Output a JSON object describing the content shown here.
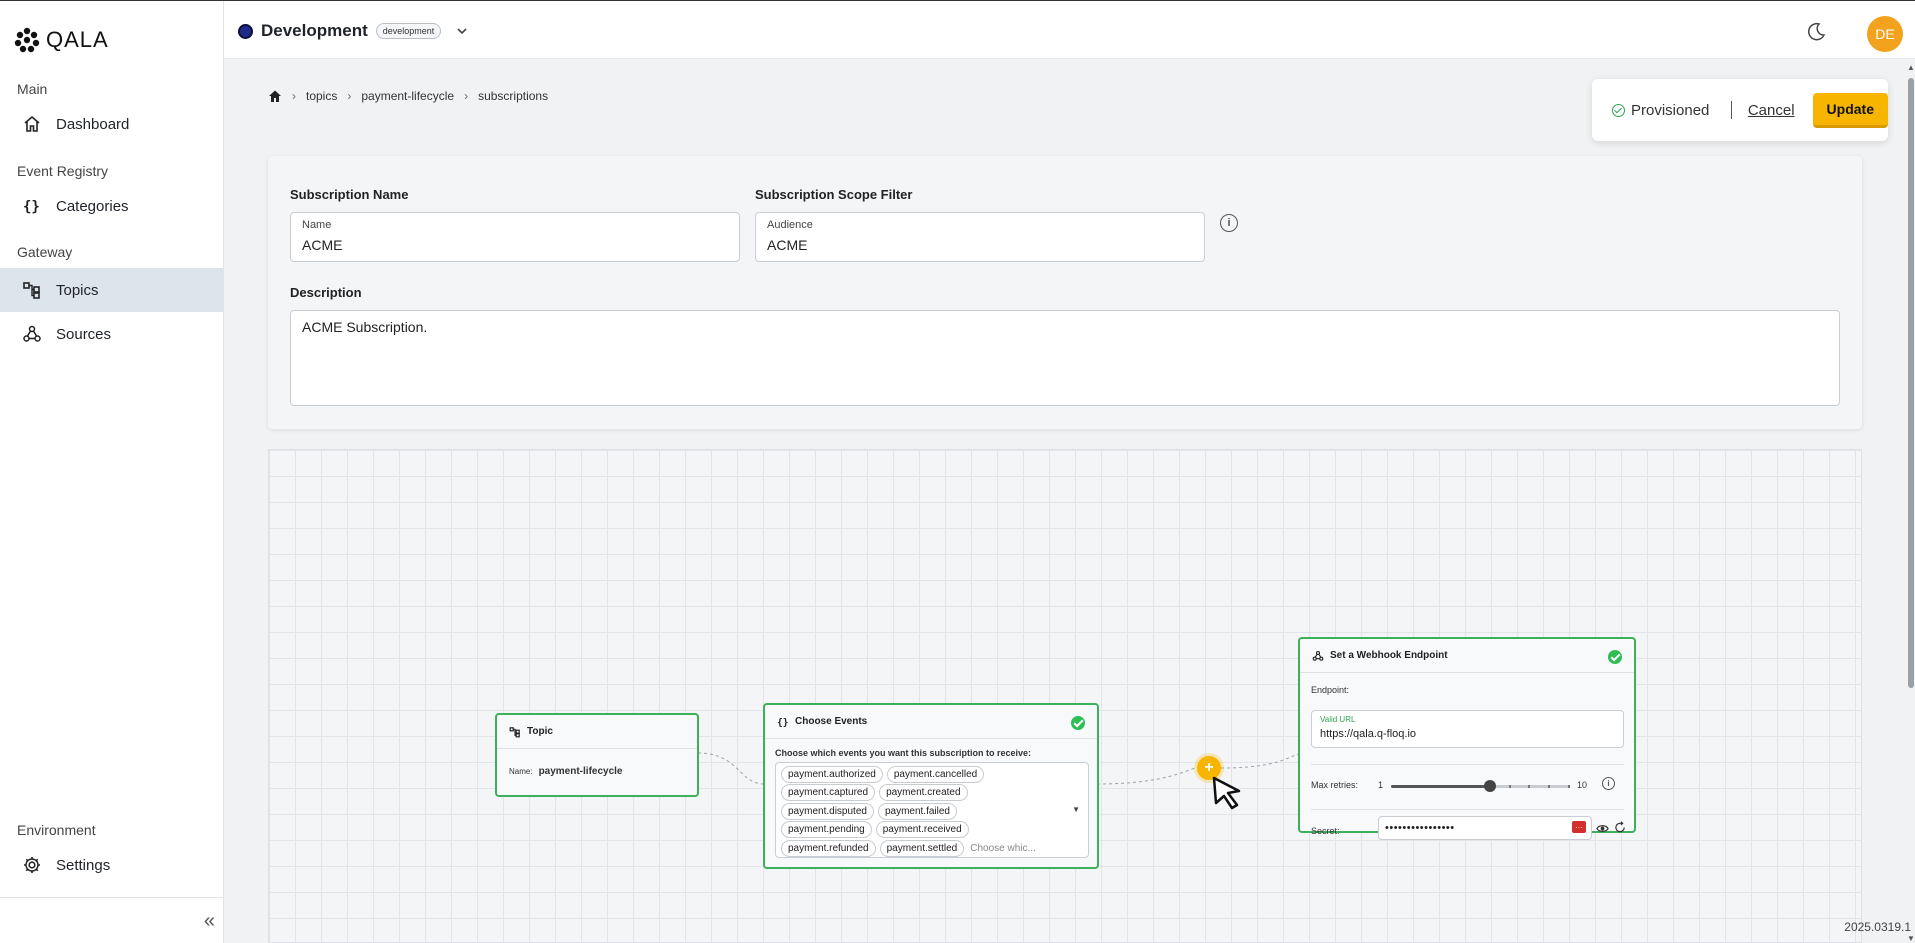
{
  "app": {
    "logo_text": "QALA",
    "version": "2025.0319.1"
  },
  "header": {
    "environment": "Development",
    "environment_badge": "development",
    "avatar_initials": "DE"
  },
  "sidebar": {
    "sections": [
      {
        "title": "Main",
        "items": [
          {
            "label": "Dashboard",
            "icon": "home-icon"
          }
        ]
      },
      {
        "title": "Event Registry",
        "items": [
          {
            "label": "Categories",
            "icon": "braces-icon"
          }
        ]
      },
      {
        "title": "Gateway",
        "items": [
          {
            "label": "Topics",
            "icon": "topics-icon",
            "active": true
          },
          {
            "label": "Sources",
            "icon": "webhook-icon"
          }
        ]
      },
      {
        "title": "Environment",
        "items": [
          {
            "label": "Settings",
            "icon": "gear-icon"
          }
        ]
      }
    ],
    "collapse_label": "«"
  },
  "breadcrumb": [
    "topics",
    "payment-lifecycle",
    "subscriptions"
  ],
  "actions": {
    "status": "Provisioned",
    "cancel": "Cancel",
    "update": "Update"
  },
  "form": {
    "name_label": "Subscription Name",
    "name_caption": "Name",
    "name_value": "ACME",
    "scope_label": "Subscription Scope Filter",
    "scope_caption": "Audience",
    "scope_value": "ACME",
    "description_label": "Description",
    "description_value": "ACME Subscription."
  },
  "flow": {
    "topic_node": {
      "title": "Topic",
      "name_label": "Name:",
      "name_value": "payment-lifecycle"
    },
    "events_node": {
      "title": "Choose Events",
      "prompt": "Choose which events you want this subscription to receive:",
      "events": [
        [
          "payment.authorized",
          "payment.cancelled"
        ],
        [
          "payment.captured",
          "payment.created"
        ],
        [
          "payment.disputed",
          "payment.failed"
        ],
        [
          "payment.pending",
          "payment.received"
        ],
        [
          "payment.refunded",
          "payment.settled"
        ]
      ],
      "placeholder": "Choose whic..."
    },
    "webhook_node": {
      "title": "Set a Webhook Endpoint",
      "endpoint_label": "Endpoint:",
      "valid_caption": "Valid URL",
      "url": "https://qala.q-floq.io",
      "retries_label": "Max retries:",
      "retries_min": "1",
      "retries_max": "10",
      "retries_value": 6,
      "secret_label": "Secret:",
      "secret_value": "••••••••••••••••"
    },
    "add_button": "+"
  },
  "colors": {
    "accent": "#f7b500",
    "success": "#3cb05a",
    "avatar": "#f2a21c"
  }
}
